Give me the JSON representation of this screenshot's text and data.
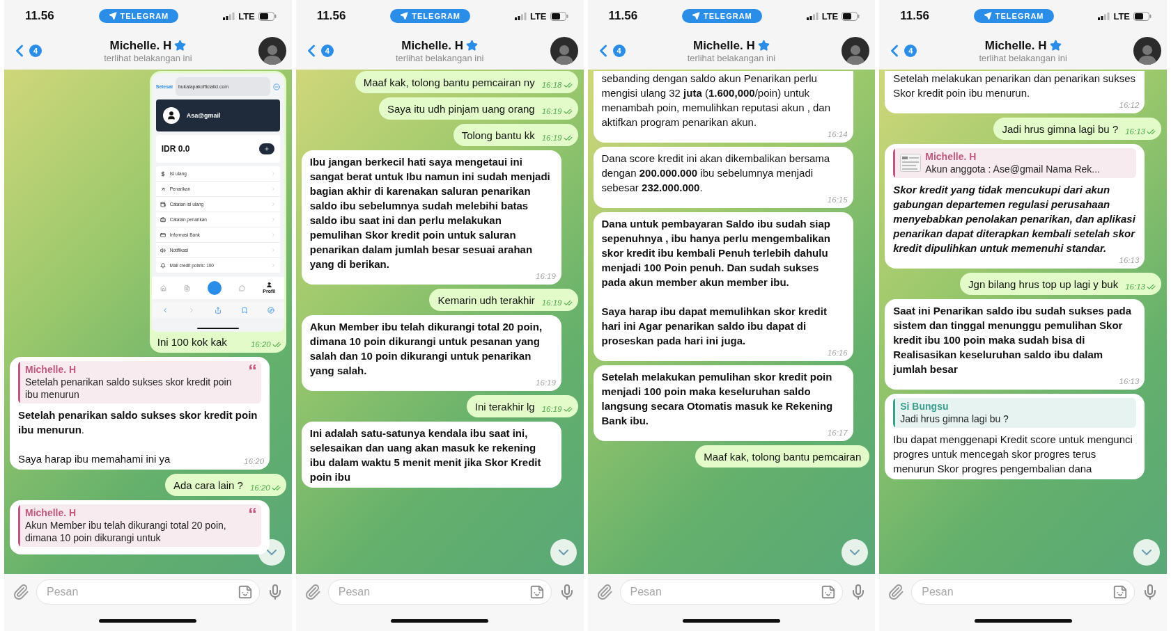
{
  "panels": [
    {
      "status": {
        "time": "11.56",
        "app_pill": "TELEGRAM",
        "network": "LTE"
      },
      "header": {
        "back_badge": "4",
        "title": "Michelle. H",
        "starred": true,
        "subtitle": "terlihat belakangan ini"
      },
      "messages": [
        {
          "kind": "image",
          "paragraphs": [
            "Ini 100 kok kak"
          ],
          "time": "16:20",
          "read": true,
          "screenshot": {
            "done": "Selesai",
            "url": "bukalapakofficialid.com",
            "account": "Asa@gmail",
            "balance": "IDR 0.0",
            "menu": [
              "Isi ulang",
              "Penarikan",
              "Catatan isi ulang",
              "Catatan penarikan",
              "Informasi Bank",
              "Notifikasi",
              "Mall credit points:  100"
            ],
            "tab_label": "Profil"
          }
        },
        {
          "kind": "incoming",
          "quote": {
            "author": "Michelle. H",
            "text": "Setelah penarikan saldo sukses skor kredit poin ibu menurun",
            "color": "#c0577e",
            "quote_mark": true
          },
          "paragraphs": [
            "**Setelah penarikan saldo sukses skor kredit poin ibu menurun**.",
            "Saya harap ibu memahami ini ya"
          ],
          "time": "16:20"
        },
        {
          "kind": "out",
          "paragraphs": [
            "Ada cara lain ?"
          ],
          "time": "16:20",
          "read": true
        },
        {
          "kind": "incoming",
          "quote": {
            "author": "Michelle. H",
            "text": "Akun Member ibu telah dikurangi total 20 poin, dimana 10 poin dikurangi untuk",
            "color": "#c0577e",
            "quote_mark": true
          }
        }
      ],
      "scroll_button": true,
      "composer": {
        "placeholder": "Pesan"
      }
    },
    {
      "status": {
        "time": "11.56",
        "app_pill": "TELEGRAM",
        "network": "LTE"
      },
      "header": {
        "back_badge": "4",
        "title": "Michelle. H",
        "starred": true,
        "subtitle": "terlihat belakangan ini"
      },
      "messages": [
        {
          "kind": "out",
          "paragraphs": [
            "Maaf kak, tolong bantu pemcairan ny"
          ],
          "time": "16:18",
          "read": true
        },
        {
          "kind": "out",
          "paragraphs": [
            "Saya itu udh pinjam uang orang"
          ],
          "time": "16:19",
          "read": true
        },
        {
          "kind": "out",
          "paragraphs": [
            "Tolong bantu kk"
          ],
          "time": "16:19",
          "read": true
        },
        {
          "kind": "incoming_bold",
          "paragraphs": [
            "Ibu jangan berkecil hati saya mengetaui ini sangat berat untuk Ibu namun ini sudah menjadi bagian akhir di karenakan saluran penarikan saldo ibu sebelumnya sudah melebihi batas saldo ibu saat ini dan perlu melakukan pemulihan Skor kredit poin untuk saluran penarikan dalam jumlah besar sesuai arahan yang di berikan."
          ],
          "time": "16:19"
        },
        {
          "kind": "out",
          "paragraphs": [
            "Kemarin udh terakhir"
          ],
          "time": "16:19",
          "read": true
        },
        {
          "kind": "incoming_bold",
          "paragraphs": [
            "Akun Member ibu telah dikurangi total 20 poin, dimana 10 poin dikurangi untuk pesanan yang salah dan 10 poin dikurangi untuk penarikan yang salah."
          ],
          "time": "16:19"
        },
        {
          "kind": "out",
          "paragraphs": [
            "Ini terakhir lg"
          ],
          "time": "16:19",
          "read": true
        },
        {
          "kind": "incoming_bold",
          "paragraphs": [
            "Ini adalah satu-satunya kendala ibu saat ini, selesaikan dan uang akan masuk ke rekening ibu dalam waktu 5 menit menit jika Skor Kredit poin ibu"
          ]
        }
      ],
      "scroll_button": true,
      "composer": {
        "placeholder": "Pesan"
      }
    },
    {
      "status": {
        "time": "11.56",
        "app_pill": "TELEGRAM",
        "network": "LTE"
      },
      "header": {
        "back_badge": "4",
        "title": "Michelle. H",
        "starred": true,
        "subtitle": "terlihat belakangan ini"
      },
      "messages": [
        {
          "kind": "incoming",
          "cut_top": true,
          "paragraphs": [
            "sebanding dengan saldo akun Penarikan perlu mengisi ulang 32 **juta** (**1.600,000**/poin) untuk menambah poin, memulihkan reputasi akun , dan aktifkan program penarikan akun."
          ],
          "time": "16:14"
        },
        {
          "kind": "incoming",
          "paragraphs": [
            "Dana score kredit ini akan dikembalikan bersama dengan **200.000.000** ibu sebelumnya menjadi sebesar **232.000.000**."
          ],
          "time": "16:15"
        },
        {
          "kind": "incoming_bold",
          "paragraphs": [
            "Dana untuk pembayaran Saldo ibu sudah siap sepenuhnya , ibu hanya perlu mengembalikan skor kredit ibu kembali Penuh terlebih dahulu menjadi 100 Poin penuh. Dan sudah sukses pada akun member akun member ibu.",
            "Saya harap ibu dapat memulihkan skor kredit hari ini Agar penarikan saldo ibu dapat di proseskan pada hari ini juga."
          ],
          "time": "16:16"
        },
        {
          "kind": "incoming_bold",
          "paragraphs": [
            "Setelah melakukan pemulihan skor kredit poin menjadi 100 poin maka keseluruhan saldo langsung secara Otomatis masuk ke Rekening Bank ibu."
          ],
          "time": "16:17"
        },
        {
          "kind": "out",
          "paragraphs": [
            "Maaf kak, tolong bantu pemcairan"
          ]
        }
      ],
      "scroll_button": true,
      "composer": {
        "placeholder": "Pesan"
      }
    },
    {
      "status": {
        "time": "11.56",
        "app_pill": "TELEGRAM",
        "network": "LTE"
      },
      "header": {
        "back_badge": "4",
        "title": "Michelle. H",
        "starred": true,
        "subtitle": "terlihat belakangan ini"
      },
      "messages": [
        {
          "kind": "incoming",
          "cut_top": true,
          "paragraphs": [
            "Setelah melakukan penarikan dan penarikan sukses Skor kredit poin ibu menurun."
          ],
          "time": "16:12"
        },
        {
          "kind": "out",
          "paragraphs": [
            "Jadi hrus gimna lagi bu ?"
          ],
          "time": "16:13",
          "read": true
        },
        {
          "kind": "incoming_italic",
          "quote": {
            "author": "Michelle. H",
            "text": "Akun anggota : Ase@gmail Nama Rek...",
            "color": "#c0577e",
            "thumbnail": true
          },
          "paragraphs": [
            "Skor kredit yang tidak mencukupi dari akun gabungan departemen regulasi perusahaan menyebabkan penolakan penarikan, dan aplikasi penarikan dapat diterapkan kembali setelah skor kredit dipulihkan untuk memenuhi standar."
          ],
          "time": "16:13"
        },
        {
          "kind": "out",
          "paragraphs": [
            "Jgn bilang hrus top up lagi y buk"
          ],
          "time": "16:13",
          "read": true
        },
        {
          "kind": "incoming_bold",
          "paragraphs": [
            "Saat ini Penarikan saldo ibu sudah sukses pada sistem dan tinggal menunggu pemulihan Skor kredit ibu 100 poin maka sudah bisa di Realisasikan keseluruhan saldo ibu dalam jumlah besar"
          ],
          "time": "16:13"
        },
        {
          "kind": "incoming",
          "quote": {
            "author": "Si Bungsu",
            "text": "Jadi hrus gimna lagi bu ?",
            "color": "#3a9e8f"
          },
          "paragraphs": [
            "Ibu dapat menggenapi Kredit score untuk mengunci progres untuk mencegah skor progres terus menurun Skor progres pengembalian dana"
          ]
        }
      ],
      "scroll_button": true,
      "composer": {
        "placeholder": "Pesan"
      }
    }
  ]
}
